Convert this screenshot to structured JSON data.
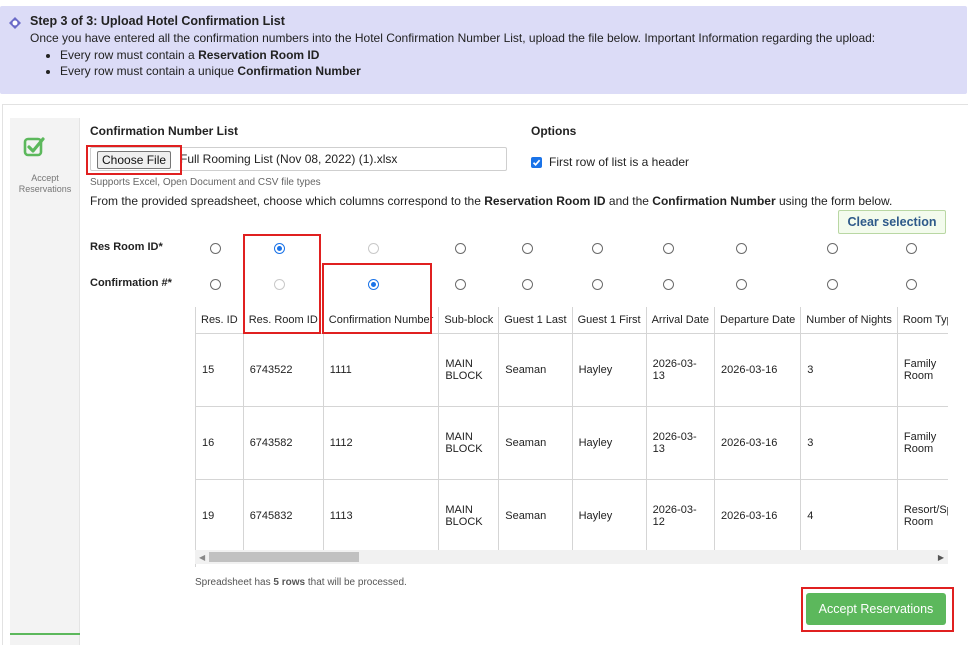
{
  "step": {
    "title": "Step 3 of 3: Upload Hotel Confirmation List",
    "description": "Once you have entered all the confirmation numbers into the Hotel Confirmation Number List, upload the file below. Important Information regarding the upload:",
    "rules": [
      {
        "prefix": "Every row must contain a ",
        "bold": "Reservation Room ID"
      },
      {
        "prefix": "Every row must contain a unique ",
        "bold": "Confirmation Number"
      }
    ]
  },
  "sidebar": {
    "label": "Accept Reservations",
    "accent_color": "#5cb85c"
  },
  "upload": {
    "section_title": "Confirmation Number List",
    "choose_file_label": "Choose File",
    "file_name": "Full Rooming List (Nov 08, 2022) (1).xlsx",
    "supported_types": "Supports Excel, Open Document and CSV file types"
  },
  "options": {
    "title": "Options",
    "header_checkbox_label": "First row of list is a header",
    "header_checkbox_checked": true
  },
  "instructions": {
    "p1": "From the provided spreadsheet, choose which columns correspond to the ",
    "b1": "Reservation Room ID",
    "p2": " and the ",
    "b2": "Confirmation Number",
    "p3": " using the form below."
  },
  "clear_selection_label": "Clear selection",
  "selectors": {
    "res_room_id_label": "Res Room ID*",
    "confirmation_label": "Confirmation #*",
    "res_room_id_selected_column": 1,
    "confirmation_selected_column": 2
  },
  "table": {
    "columns": [
      "Res. ID",
      "Res. Room ID",
      "Confirmation Number",
      "Sub-block",
      "Guest 1 Last",
      "Guest 1 First",
      "Arrival Date",
      "Departure Date",
      "Number of Nights",
      "Room Type"
    ],
    "rows": [
      [
        "15",
        "6743522",
        "1111",
        "MAIN BLOCK",
        "Seaman",
        "Hayley",
        "2026-03-13",
        "2026-03-16",
        "3",
        "Family Room"
      ],
      [
        "16",
        "6743582",
        "1112",
        "MAIN BLOCK",
        "Seaman",
        "Hayley",
        "2026-03-13",
        "2026-03-16",
        "3",
        "Family Room"
      ],
      [
        "19",
        "6745832",
        "1113",
        "MAIN BLOCK",
        "Seaman",
        "Hayley",
        "2026-03-12",
        "2026-03-16",
        "4",
        "Resort/Spa Room"
      ]
    ]
  },
  "summary": {
    "prefix": "Spreadsheet has ",
    "count": "5 rows",
    "suffix": " that will be processed."
  },
  "accept_button_label": "Accept Reservations",
  "colors": {
    "banner_bg": "#dcdcf7",
    "accent_green": "#5cb85c",
    "radio_blue": "#1a73e8",
    "highlight_red": "#e02020"
  }
}
